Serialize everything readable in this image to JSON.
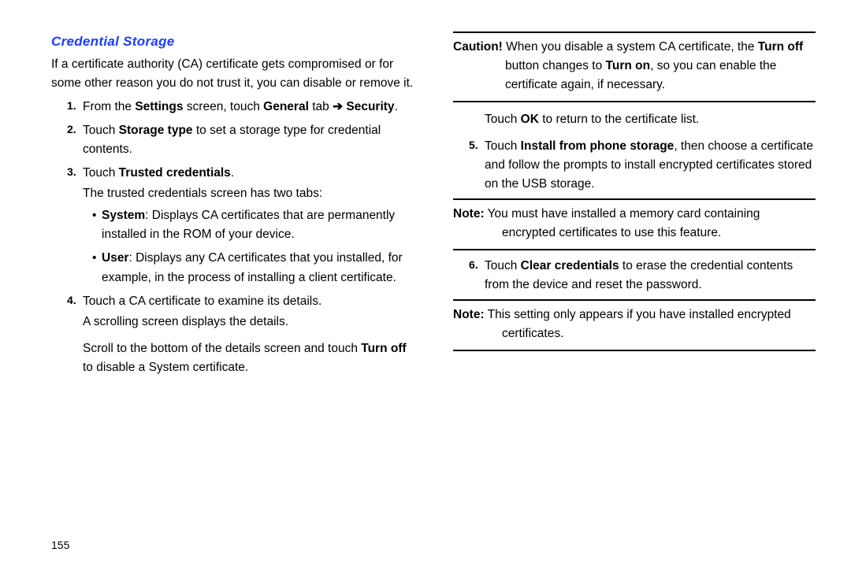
{
  "page_number": "155",
  "heading": "Credential Storage",
  "intro": "If a certificate authority (CA) certificate gets compromised or for some other reason you do not trust it, you can disable or remove it.",
  "steps": {
    "s1_pre": "From the ",
    "s1_settings": "Settings",
    "s1_mid1": " screen, touch ",
    "s1_general": "General",
    "s1_mid2": " tab ",
    "s1_arrow": "➔",
    "s1_security": "Security",
    "s1_end": ".",
    "s2_pre": "Touch ",
    "s2_storage": "Storage type",
    "s2_post": " to set a storage type for credential contents.",
    "s3_pre": "Touch ",
    "s3_trusted": "Trusted credentials",
    "s3_end": ".",
    "s3_sub": "The trusted credentials screen has two tabs:",
    "s3_b1_head": "System",
    "s3_b1_text": ": Displays CA certificates that are permanently installed in the ROM of your device.",
    "s3_b2_head": "User",
    "s3_b2_text": ": Displays any CA certificates that you installed, for example, in the process of installing a client certificate.",
    "s4_l1": "Touch a CA certificate to examine its details.",
    "s4_l2": "A scrolling screen displays the details.",
    "s4_l3a": "Scroll to the bottom of the details screen and touch ",
    "s4_turnoff": "Turn off",
    "s4_l3b": " to disable a System certificate.",
    "s5_pre": "Touch ",
    "s5_install": "Install from phone storage",
    "s5_post": ", then choose a certificate and follow the prompts to install encrypted certificates stored on the USB storage.",
    "s6_pre": "Touch ",
    "s6_clear": "Clear credentials",
    "s6_post": " to erase the credential contents from the device and reset the password."
  },
  "caution": {
    "label": "Caution!",
    "t1": " When you disable a system CA certificate, the ",
    "turnoff": "Turn off",
    "t2": " button changes to ",
    "turnon": "Turn on",
    "t3": ", so you can enable the certificate again, if necessary."
  },
  "ok_line": {
    "pre": "Touch ",
    "ok": "OK",
    "post": " to return to the certificate list."
  },
  "note1": {
    "label": "Note:",
    "text": " You must have installed a memory card containing encrypted certificates to use this feature."
  },
  "note2": {
    "label": "Note:",
    "text": " This setting only appears if you have installed encrypted certificates."
  }
}
